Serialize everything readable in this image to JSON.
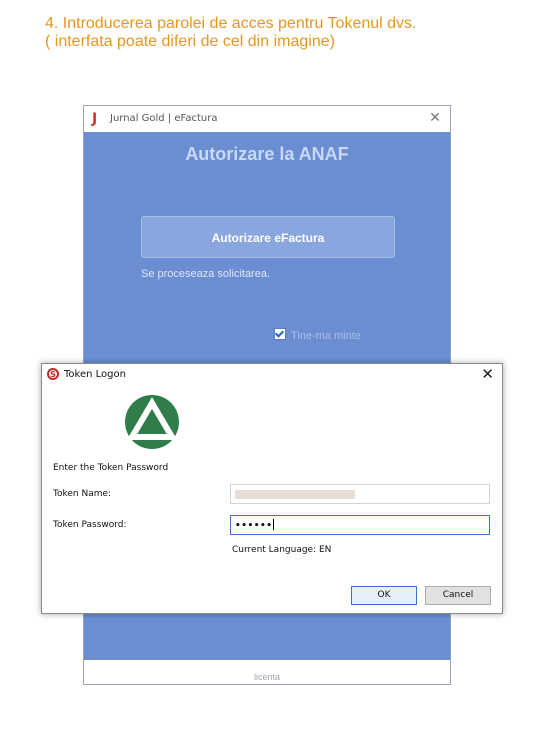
{
  "caption": {
    "line1": "4. Introducerea parolei de acces pentru Tokenul dvs.",
    "line2": "( interfata poate diferi de cel din imagine)"
  },
  "app_window": {
    "title": "Jurnal Gold | eFactura",
    "heading": "Autorizare la ANAF",
    "authorize_button": "Autorizare eFactura",
    "status": "Se proceseaza solicitarea.",
    "remember_me": "Tine-ma minte",
    "remember_checked": true,
    "footer": "licenta",
    "colors": {
      "panel": "#6b8ed3",
      "logo": "#d0362c"
    }
  },
  "token_dialog": {
    "title": "Token Logon",
    "prompt": "Enter the Token Password",
    "token_name_label": "Token Name:",
    "token_password_label": "Token Password:",
    "password_masked": "••••••",
    "current_language": "Current Language:  EN",
    "ok_button": "OK",
    "cancel_button": "Cancel",
    "icons": {
      "app": "red-s-icon",
      "logo": "triangle-logo-icon"
    },
    "colors": {
      "logo_green": "#2e7d4a",
      "focus": "#3a75d0"
    }
  }
}
